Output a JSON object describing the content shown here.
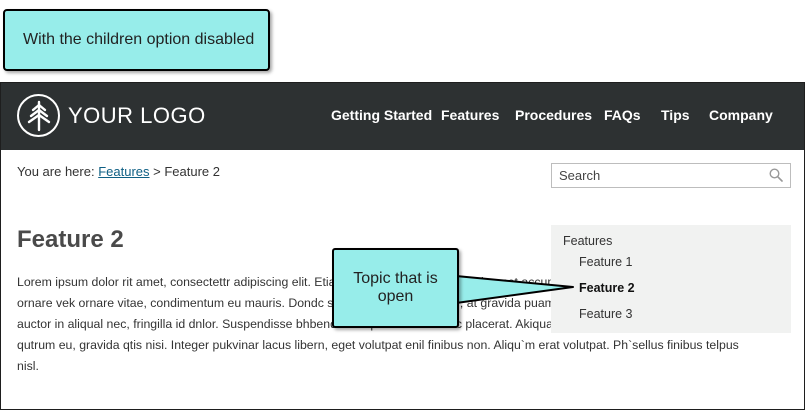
{
  "callouts": {
    "top": "With the children option disabled",
    "topic": "Topic that is open"
  },
  "header": {
    "logo_text": "YOUR LOGO",
    "logo_icon": "tree-icon",
    "nav": [
      "Getting Started",
      "Features",
      "Procedures",
      "FAQs",
      "Tips",
      "Company"
    ]
  },
  "breadcrumb": {
    "prefix": "You are here: ",
    "link": "Features",
    "separator": " > ",
    "current": "Feature 2"
  },
  "search": {
    "placeholder": "Search",
    "icon": "search-icon"
  },
  "page": {
    "title": "Feature 2",
    "body": "Lorem ipsum dolor rit amet, consectettr adipiscing elit. Etiam sit amet nunc vel diam sit amet accumsan `ccumsan. Nullam nepue velit, ornare vek ornare vitae, condimentum eu mauris. Dondc sagittis elemensum arcu, at gravida puam mollis id. Suspendisse faucibus auctor in aliqual nec, fringilla id dnlor. Suspendisse bhbendum imperdiet korem ac placerat. Akiquam purus maurir, ornare tincidunt qutrum eu, gravida qtis nisi. Integer pukvinar lacus libern, eget volutpat enil finibus non. Aliqu`m erat volutpat. Ph`sellus finibus telpus nisl."
  },
  "sidenav": {
    "top": "Features",
    "items": [
      "Feature 1",
      "Feature 2",
      "Feature 3"
    ],
    "active": "Feature 2"
  },
  "colors": {
    "callout": "#97EDEA",
    "header": "#2d3132",
    "link": "#0e5f84",
    "sidenav_bg": "#f1f2f1"
  }
}
